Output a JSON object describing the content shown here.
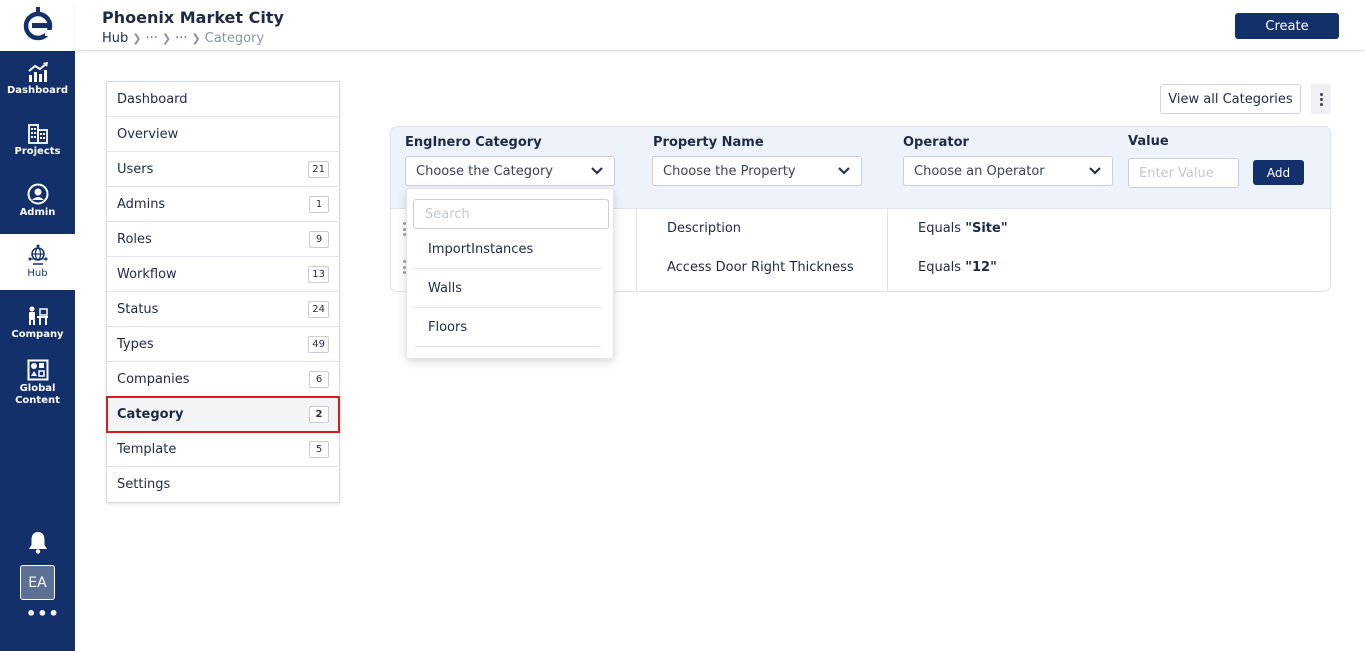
{
  "app": {
    "title": "Phoenix Market City",
    "logo_icon": "engineero-e-logo",
    "accent_color": "#13306b",
    "highlight_color": "#d81b1b"
  },
  "breadcrumb": {
    "root": "Hub",
    "collapsed_1": "···",
    "collapsed_2": "···",
    "current": "Category"
  },
  "header": {
    "create_label": "Create"
  },
  "rail": {
    "items": [
      {
        "label": "Dashboard",
        "icon": "chart-up-icon"
      },
      {
        "label": "Projects",
        "icon": "buildings-icon"
      },
      {
        "label": "Admin",
        "icon": "user-circle-icon"
      },
      {
        "label": "Hub",
        "icon": "globe-network-icon",
        "active": true
      },
      {
        "label": "Company",
        "icon": "company-desk-icon"
      },
      {
        "label": "Global Content",
        "icon": "shapes-grid-icon"
      }
    ],
    "avatar": "EA",
    "more": "•••"
  },
  "menu": {
    "items": [
      {
        "label": "Dashboard",
        "count": ""
      },
      {
        "label": "Overview",
        "count": ""
      },
      {
        "label": "Users",
        "count": "21"
      },
      {
        "label": "Admins",
        "count": "1"
      },
      {
        "label": "Roles",
        "count": "9"
      },
      {
        "label": "Workflow",
        "count": "13"
      },
      {
        "label": "Status",
        "count": "24"
      },
      {
        "label": "Types",
        "count": "49"
      },
      {
        "label": "Companies",
        "count": "6"
      },
      {
        "label": "Category",
        "count": "2",
        "active": true
      },
      {
        "label": "Template",
        "count": "5"
      },
      {
        "label": "Settings",
        "count": ""
      }
    ]
  },
  "content": {
    "view_all_label": "View all Categories",
    "form": {
      "category_label": "EngInero Category",
      "category_placeholder": "Choose the Category",
      "property_label": "Property Name",
      "property_placeholder": "Choose the Property",
      "operator_label": "Operator",
      "operator_placeholder": "Choose an Operator",
      "value_label": "Value",
      "value_placeholder": "Enter Value",
      "add_label": "Add"
    },
    "rules": [
      {
        "property": "Description",
        "operator": "Equals",
        "value": "\"Site\""
      },
      {
        "property": "Access Door Right Thickness",
        "operator": "Equals",
        "value": "\"12\""
      }
    ],
    "dropdown": {
      "search_placeholder": "Search",
      "options": [
        "ImportInstances",
        "Walls",
        "Floors"
      ]
    }
  }
}
